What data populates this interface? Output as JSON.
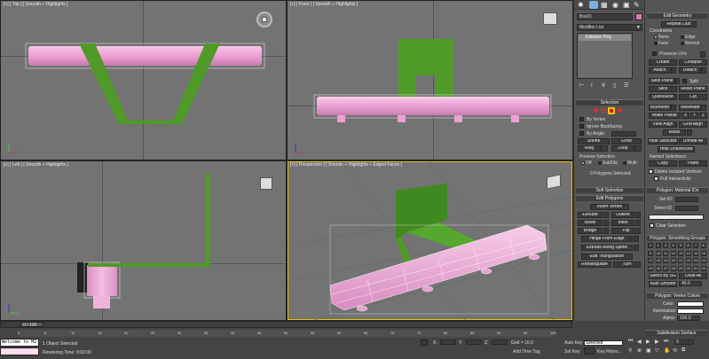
{
  "viewports": {
    "top": "[+] [ Top ] [ Smooth + Highlights ]",
    "front": "[+] [ Front ] [ Smooth + Highlights ]",
    "left": "[+] [ Left ] [ Smooth + Highlights ]",
    "perspective": "[+] [ Perspective ] [ Smooth + Highlights + Edged Faces ]"
  },
  "command_panel": {
    "object_name": "Box01",
    "modifier_list": "Modifier List",
    "stack_item": "Editable Poly",
    "selection": {
      "title": "Selection",
      "by_vertex": "By Vertex",
      "ignore_backfacing": "Ignore Backfacing",
      "by_angle": "By Angle:",
      "shrink": "Shrink",
      "grow": "Grow",
      "ring": "Ring",
      "loop": "Loop",
      "preview_selection": "Preview Selection",
      "off": "Off",
      "subobj": "SubObj",
      "multi": "Multi",
      "status": "0 Polygons Selected"
    },
    "soft_selection": "Soft Selection",
    "edit_polygons": {
      "title": "Edit Polygons",
      "insert_vertex": "Insert Vertex",
      "extrude": "Extrude",
      "outline": "Outline",
      "bevel": "Bevel",
      "inset": "Inset",
      "bridge": "Bridge",
      "flip": "Flip",
      "hinge": "Hinge From Edge",
      "extrude_spline": "Extrude Along Spline",
      "edit_triangulation": "Edit Triangulation",
      "retriangulate": "Retriangulate",
      "turn": "Turn"
    }
  },
  "rollout": {
    "edit_geometry": "Edit Geometry",
    "repeat_last": "Repeat Last",
    "constraints": "Constraints",
    "none": "None",
    "edge": "Edge",
    "face": "Face",
    "normal": "Normal",
    "preserve_uvs": "Preserve UVs",
    "create": "Create",
    "collapse": "Collapse",
    "attach": "Attach",
    "detach": "Detach",
    "slice_plane": "Slice Plane",
    "split": "Split",
    "slice": "Slice",
    "reset_plane": "Reset Plane",
    "quickslice": "QuickSlice",
    "cut": "Cut",
    "msmooth": "MSmooth",
    "tessellate": "Tessellate",
    "make_planar": "Make Planar",
    "x": "X",
    "y": "Y",
    "z": "Z",
    "view_align": "View Align",
    "grid_align": "Grid Align",
    "relax": "Relax",
    "hide_selected": "Hide Selected",
    "unhide_all": "Unhide All",
    "hide_unselected": "Hide Unselected",
    "named_selections": "Named Selections:",
    "copy": "Copy",
    "paste": "Paste",
    "delete_isolated": "Delete Isolated Vertices",
    "full_interactivity": "Full Interactivity",
    "material_ids": "Polygon: Material IDs",
    "set_id": "Set ID:",
    "select_id": "Select ID",
    "clear_selection": "Clear Selection",
    "smoothing_groups": "Polygon: Smoothing Groups",
    "sg_numbers": [
      "1",
      "2",
      "3",
      "4",
      "5",
      "6",
      "7",
      "8",
      "9",
      "10",
      "11",
      "12",
      "13",
      "14",
      "15",
      "16",
      "17",
      "18",
      "19",
      "20",
      "21",
      "22",
      "23",
      "24",
      "25",
      "26",
      "27",
      "28",
      "29",
      "30",
      "31",
      "32"
    ],
    "select_by_sg": "Select By SG",
    "clear_all": "Clear All",
    "auto_smooth": "Auto Smooth",
    "auto_smooth_value": "45.0",
    "vertex_colors": "Polygon: Vertex Colors",
    "color": "Color:",
    "illumination": "Illumination:",
    "alpha": "Alpha:",
    "alpha_value": "100.0",
    "subdivision_surface": "Subdivision Surface"
  },
  "bottom": {
    "frame_counter": "0 / 100",
    "ruler_ticks": [
      "0",
      "5",
      "10",
      "15",
      "20",
      "25",
      "30",
      "35",
      "40",
      "45",
      "50",
      "55",
      "60",
      "65",
      "70",
      "75",
      "80",
      "85",
      "90",
      "95",
      "100"
    ],
    "maxscript": "Welcome to M2",
    "status_selected": "1 Object Selected",
    "rendering_time": "Rendering Time: 0:00:00",
    "x_label": "X:",
    "y_label": "Y:",
    "z_label": "Z:",
    "grid": "Grid = 10.0",
    "add_time_tag": "Add Time Tag",
    "auto_key": "Auto Key",
    "set_key": "Set Key",
    "selected": "Selected",
    "key_filters": "Key Filters...",
    "frame_value": "0"
  },
  "colors": {
    "pink": "#f0a8d8",
    "green": "#4f9a28",
    "viewport_bg": "#737373",
    "active_border": "#e8c400"
  }
}
